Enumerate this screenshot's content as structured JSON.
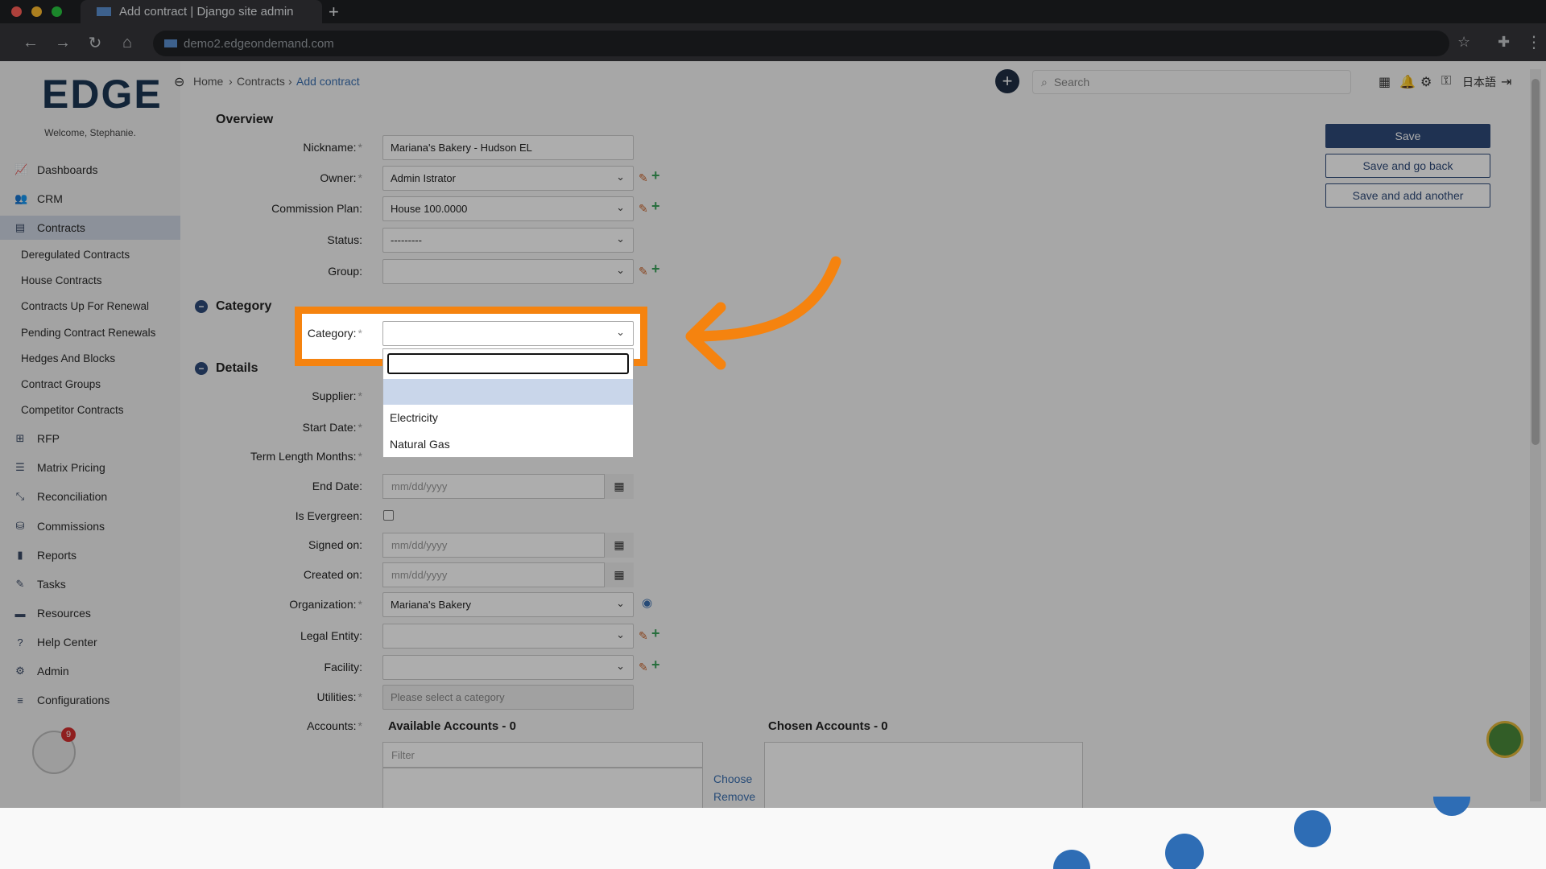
{
  "browser": {
    "tab_title": "Add contract | Django site admin",
    "new_tab": "+",
    "url": "demo2.edgeondemand.com"
  },
  "sidebar": {
    "logo": "EDGE",
    "welcome": "Welcome, Stephanie.",
    "items": [
      {
        "label": "Dashboards",
        "icon": "chart-line-icon"
      },
      {
        "label": "CRM",
        "icon": "users-icon"
      },
      {
        "label": "Contracts",
        "icon": "file-icon",
        "active": true
      },
      {
        "label": "RFP",
        "icon": "sitemap-icon"
      },
      {
        "label": "Matrix Pricing",
        "icon": "list-icon"
      },
      {
        "label": "Reconciliation",
        "icon": "compress-icon"
      },
      {
        "label": "Commissions",
        "icon": "coins-icon"
      },
      {
        "label": "Reports",
        "icon": "bar-chart-icon"
      },
      {
        "label": "Tasks",
        "icon": "tasks-icon"
      },
      {
        "label": "Resources",
        "icon": "folder-icon"
      },
      {
        "label": "Help Center",
        "icon": "question-icon"
      },
      {
        "label": "Admin",
        "icon": "cogs-icon"
      },
      {
        "label": "Configurations",
        "icon": "sliders-icon"
      }
    ],
    "sub_items": [
      "Deregulated Contracts",
      "House Contracts",
      "Contracts Up For Renewal",
      "Pending Contract Renewals",
      "Hedges And Blocks",
      "Contract Groups",
      "Competitor Contracts"
    ],
    "badge_count": "9"
  },
  "header": {
    "breadcrumb": [
      "Home",
      "Contracts",
      "Add contract"
    ],
    "search_placeholder": "Search",
    "lang": "日本語"
  },
  "actions": {
    "save": "Save",
    "save_go_back": "Save and go back",
    "save_add_another": "Save and add another"
  },
  "form": {
    "overview_title": "Overview",
    "category_title": "Category",
    "details_title": "Details",
    "nickname_label": "Nickname:",
    "nickname_value": "Mariana's Bakery - Hudson EL",
    "owner_label": "Owner:",
    "owner_value": "Admin Istrator",
    "commission_label": "Commission Plan:",
    "commission_value": "House 100.0000",
    "status_label": "Status:",
    "status_value": "---------",
    "group_label": "Group:",
    "category_label": "Category:",
    "category_options": [
      "Electricity",
      "Natural Gas"
    ],
    "supplier_label": "Supplier:",
    "start_date_label": "Start Date:",
    "term_label": "Term Length Months:",
    "end_date_label": "End Date:",
    "date_placeholder": "mm/dd/yyyy",
    "evergreen_label": "Is Evergreen:",
    "signed_label": "Signed on:",
    "created_label": "Created on:",
    "org_label": "Organization:",
    "org_value": "Mariana's Bakery",
    "legal_label": "Legal Entity:",
    "facility_label": "Facility:",
    "utilities_label": "Utilities:",
    "utilities_placeholder": "Please select a category",
    "accounts_label": "Accounts:",
    "available_title": "Available Accounts - 0",
    "chosen_title": "Chosen Accounts - 0",
    "filter_placeholder": "Filter",
    "choose": "Choose",
    "remove": "Remove",
    "required_mark": "*"
  },
  "colors": {
    "highlight": "#f5830f",
    "primary": "#2f4b7a",
    "sidebar_active": "#cfd6e3"
  }
}
